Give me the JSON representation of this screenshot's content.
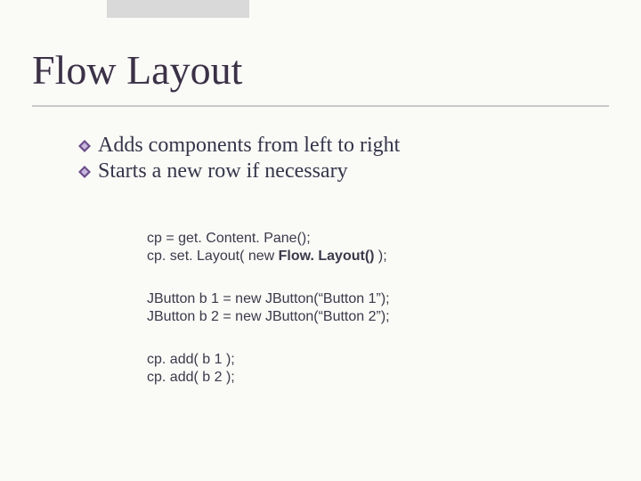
{
  "title": "Flow Layout",
  "bullets": [
    "Adds components from left to right",
    "Starts a new row if necessary"
  ],
  "code": {
    "block1": {
      "l1a": "cp = get. Content. Pane();",
      "l2a": "cp. set. Layout( new ",
      "l2b": "Flow. Layout()",
      "l2c": " );"
    },
    "block2": {
      "l1": "JButton b 1 = new JButton(“Button 1”);",
      "l2": "JButton b 2 = new JButton(“Button 2”);"
    },
    "block3": {
      "l1": "cp. add( b 1 );",
      "l2": "cp. add( b 2 );"
    }
  }
}
